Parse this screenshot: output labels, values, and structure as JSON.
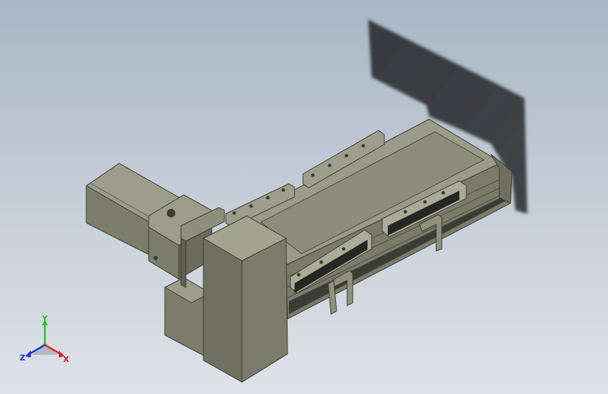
{
  "viewport": {
    "background_top": "#a9b6c5",
    "background_bottom": "#dfe3e8",
    "model_color": "#8a8b79",
    "shadow_color": "#2f3134"
  },
  "triad": {
    "x_label": "X",
    "y_label": "Y",
    "z_label": "Z",
    "x_color": "#e02020",
    "y_color": "#20c020",
    "z_color": "#2030e0"
  }
}
